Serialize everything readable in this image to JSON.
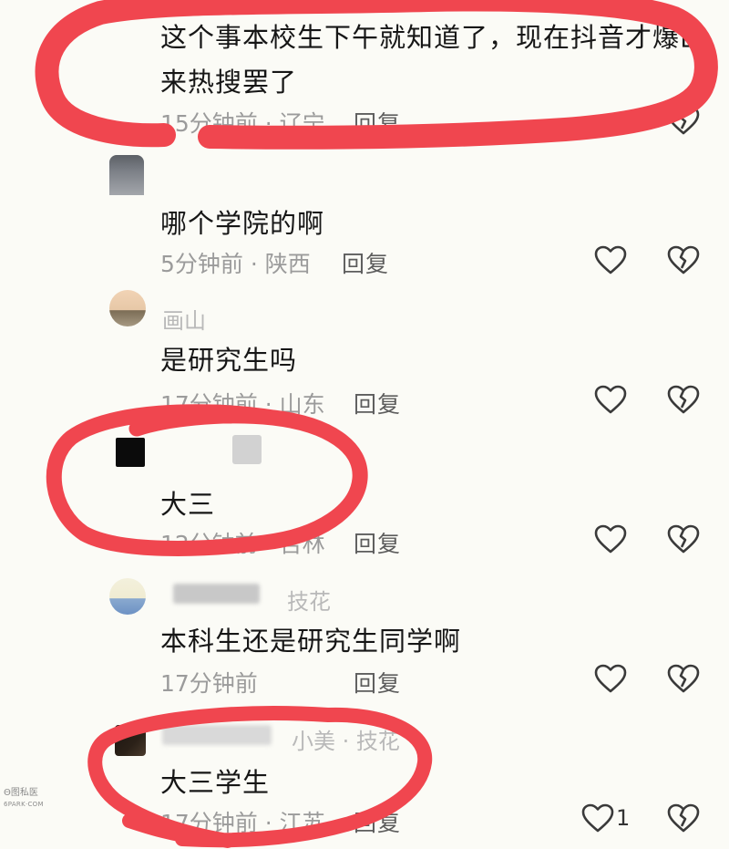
{
  "comments": [
    {
      "text_line1": "这个事本校生下午就知道了，现在抖音才爆出",
      "text_line2": "来热搜罢了",
      "meta": "15分钟前 · 辽宁",
      "reply": "回复"
    },
    {
      "text": "哪个学院的啊",
      "meta": "5分钟前 · 陕西",
      "reply": "回复"
    },
    {
      "username": "画山",
      "text": "是研究生吗",
      "meta": "17分钟前 · 山东",
      "reply": "回复"
    },
    {
      "text": "大三",
      "meta": "12分钟前 · 吉林",
      "reply": "回复"
    },
    {
      "username": "技花",
      "text": "本科生还是研究生同学啊",
      "meta": "17分钟前",
      "reply": "回复"
    },
    {
      "username": "小美 · 技花",
      "text": "大三学生",
      "meta": "17分钟前 · 江苏",
      "reply": "回复",
      "likes": "1"
    }
  ],
  "icons": {
    "like": "heart-outline-icon",
    "dislike": "broken-heart-icon"
  },
  "colors": {
    "annotation_red": "#f0464f",
    "background": "#fbfbf6",
    "text": "#161616",
    "meta": "#9b9b9b"
  },
  "watermark": {
    "line1": "Θ图私医",
    "line2": "6PARK·COM"
  }
}
